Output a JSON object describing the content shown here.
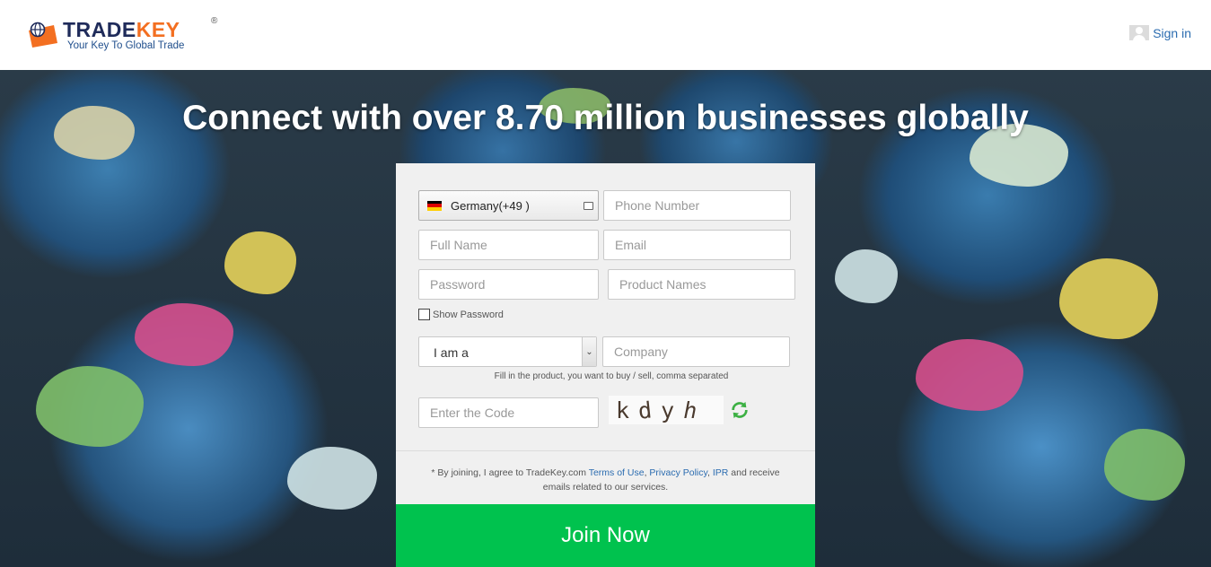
{
  "header": {
    "logo": {
      "title_trade": "TRADE",
      "title_key": "KEY",
      "registered": "®",
      "tagline": "Your Key To Global Trade"
    },
    "signin_label": "Sign in"
  },
  "hero": {
    "title": "Connect with over 8.70 million businesses globally"
  },
  "form": {
    "country": {
      "label": "Germany(+49 )",
      "flag_colors": [
        "#000000",
        "#dd0000",
        "#ffce00"
      ]
    },
    "phone_placeholder": "Phone Number",
    "fullname_placeholder": "Full Name",
    "email_placeholder": "Email",
    "password_placeholder": "Password",
    "products_placeholder": "Product Names",
    "show_password_label": "Show Password",
    "role_select": {
      "selected": "I am a"
    },
    "company_placeholder": "Company",
    "product_hint": "Fill in the product, you want to buy / sell, comma separated",
    "code_placeholder": "Enter the Code",
    "captcha_chars": [
      "k",
      "d",
      "y",
      "h"
    ],
    "terms": {
      "prefix": "* By joining, I agree to TradeKey.com ",
      "terms_link": "Terms of Use",
      "sep1": ", ",
      "privacy_link": "Privacy Policy",
      "sep2": ", ",
      "ipr_link": "IPR",
      "suffix": " and receive emails related to our services."
    },
    "join_label": "Join Now"
  },
  "colors": {
    "accent_green": "#00c24e",
    "link_blue": "#2b6cb0",
    "brand_orange": "#f36f21",
    "brand_navy": "#1f2b5a"
  }
}
